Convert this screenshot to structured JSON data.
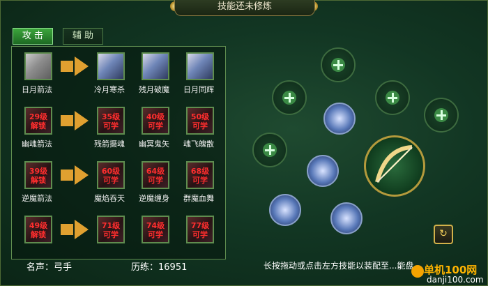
{
  "title": "技能还未修炼",
  "tabs": [
    {
      "label": "攻 击"
    },
    {
      "label": "辅 助"
    }
  ],
  "rows": [
    {
      "book": {
        "label": "日月箭法",
        "lock": ""
      },
      "skills": [
        {
          "label": "冷月寒杀",
          "lock": ""
        },
        {
          "label": "残月破魔",
          "lock": ""
        },
        {
          "label": "日月同辉",
          "lock": ""
        }
      ]
    },
    {
      "book": {
        "label": "幽魂箭法",
        "lock": "29级\n解锁"
      },
      "skills": [
        {
          "label": "残箭摄魂",
          "lock": "35级\n可学"
        },
        {
          "label": "幽冥鬼矢",
          "lock": "40级\n可学"
        },
        {
          "label": "魂飞魄散",
          "lock": "50级\n可学"
        }
      ]
    },
    {
      "book": {
        "label": "逆魔箭法",
        "lock": "39级\n解锁"
      },
      "skills": [
        {
          "label": "魔焰吞天",
          "lock": "60级\n可学"
        },
        {
          "label": "逆魔缠身",
          "lock": "64级\n可学"
        },
        {
          "label": "群魔血舞",
          "lock": "68级\n可学"
        }
      ]
    },
    {
      "book": {
        "label": "",
        "lock": "49级\n解锁"
      },
      "skills": [
        {
          "label": "",
          "lock": "71级\n可学"
        },
        {
          "label": "",
          "lock": "74级\n可学"
        },
        {
          "label": "",
          "lock": "77级\n可学"
        }
      ]
    }
  ],
  "footer": {
    "fame": "名声：弓手",
    "experience": "历练：16951",
    "hint": "长按拖动或点击左方技能以装配至...能盘"
  },
  "icons": {
    "refresh": "refresh-icon",
    "plus": "plus-icon",
    "bow": "bow-icon"
  },
  "watermark": {
    "line1": "单机100网",
    "line2": "danji100.com"
  }
}
